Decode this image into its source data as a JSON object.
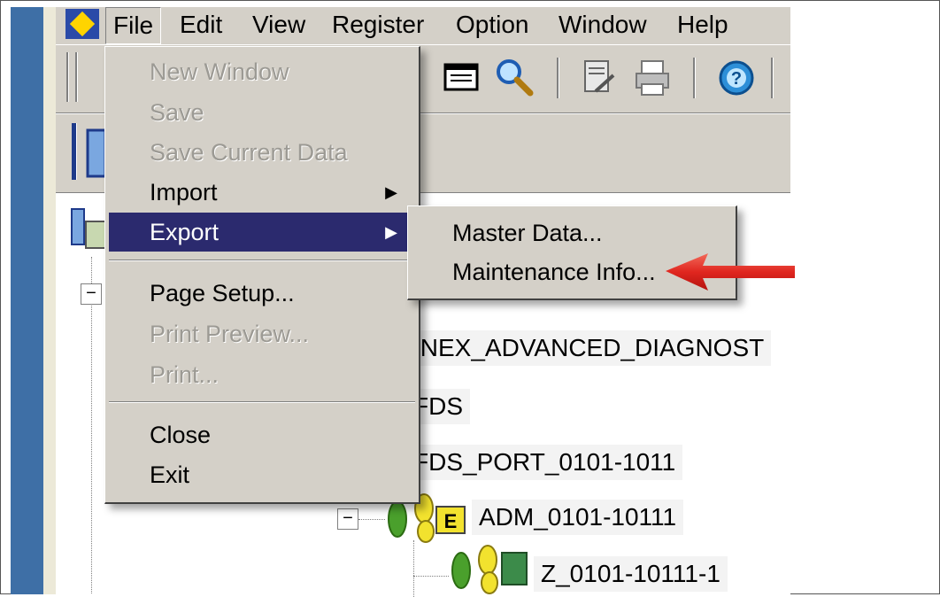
{
  "menubar": {
    "items": [
      {
        "label": "File"
      },
      {
        "label": "Edit"
      },
      {
        "label": "View"
      },
      {
        "label": "Register"
      },
      {
        "label": "Option"
      },
      {
        "label": "Window"
      },
      {
        "label": "Help"
      }
    ]
  },
  "file_menu": {
    "items": [
      {
        "label": "New Window",
        "state": "disabled"
      },
      {
        "label": "Save",
        "state": "disabled"
      },
      {
        "label": "Save Current Data",
        "state": "disabled"
      },
      {
        "label": "Import",
        "state": "enabled",
        "submenu": true
      },
      {
        "label": "Export",
        "state": "highlighted",
        "submenu": true
      },
      {
        "label": "Page Setup...",
        "state": "enabled"
      },
      {
        "label": "Print Preview...",
        "state": "disabled"
      },
      {
        "label": "Print...",
        "state": "disabled"
      },
      {
        "label": "Close",
        "state": "enabled"
      },
      {
        "label": "Exit",
        "state": "enabled"
      }
    ]
  },
  "export_submenu": {
    "items": [
      {
        "label": "Master Data..."
      },
      {
        "label": "Maintenance Info..."
      }
    ]
  },
  "tree": {
    "nodes": [
      {
        "label": "INEX_ADVANCED_DIAGNOST"
      },
      {
        "label": "FDS"
      },
      {
        "label": "FDS_PORT_0101-1011"
      },
      {
        "label": "ADM_0101-10111"
      },
      {
        "label": "Z_0101-10111-1"
      }
    ],
    "expander_symbol": "−"
  },
  "colors": {
    "menu_bg": "#d4d0c8",
    "highlight": "#2b2a6e",
    "disabled_text": "#9c9a94",
    "annotation_arrow": "#e0261f",
    "sidebar": "#3e6fa6"
  },
  "icons": [
    "app-logo-icon",
    "print-preview-icon",
    "search-icon",
    "edit-doc-icon",
    "printer-icon",
    "help-icon",
    "device-icon",
    "network-icon",
    "adm-icon",
    "module-icon"
  ]
}
